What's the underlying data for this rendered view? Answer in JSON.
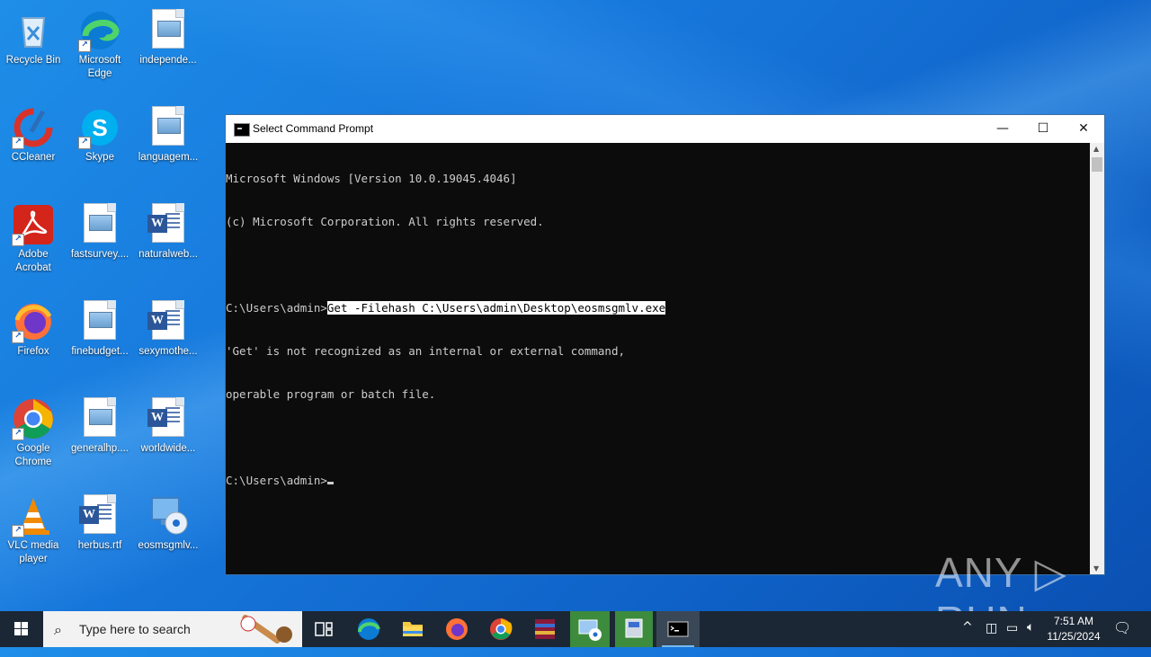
{
  "desktop": {
    "icons": [
      {
        "label": "Recycle Bin"
      },
      {
        "label": "Microsoft Edge"
      },
      {
        "label": "independe..."
      },
      {
        "label": "CCleaner"
      },
      {
        "label": "Skype"
      },
      {
        "label": "languagem..."
      },
      {
        "label": "Adobe Acrobat"
      },
      {
        "label": "fastsurvey...."
      },
      {
        "label": "naturalweb..."
      },
      {
        "label": "Firefox"
      },
      {
        "label": "finebudget..."
      },
      {
        "label": "sexymothe..."
      },
      {
        "label": "Google Chrome"
      },
      {
        "label": "generalhp...."
      },
      {
        "label": "worldwide..."
      },
      {
        "label": "VLC media player"
      },
      {
        "label": "herbus.rtf"
      },
      {
        "label": "eosmsgmlv..."
      }
    ]
  },
  "window": {
    "title": "Select Command Prompt",
    "controls": {
      "minimize": "—",
      "maximize": "☐",
      "close": "✕"
    },
    "console": {
      "line1": "Microsoft Windows [Version 10.0.19045.4046]",
      "line2": "(c) Microsoft Corporation. All rights reserved.",
      "prompt1": "C:\\Users\\admin>",
      "selected_command": "Get -Filehash C:\\Users\\admin\\Desktop\\eosmsgmlv.exe",
      "error1": "'Get' is not recognized as an internal or external command,",
      "error2": "operable program or batch file.",
      "prompt2": "C:\\Users\\admin>"
    }
  },
  "watermark": "ANY ▷ RUN",
  "taskbar": {
    "search_placeholder": "Type here to search",
    "clock_time": "7:51 AM",
    "clock_date": "11/25/2024",
    "colors": {
      "background": "#1b2735",
      "active_indicator": "#76b9ed"
    }
  }
}
